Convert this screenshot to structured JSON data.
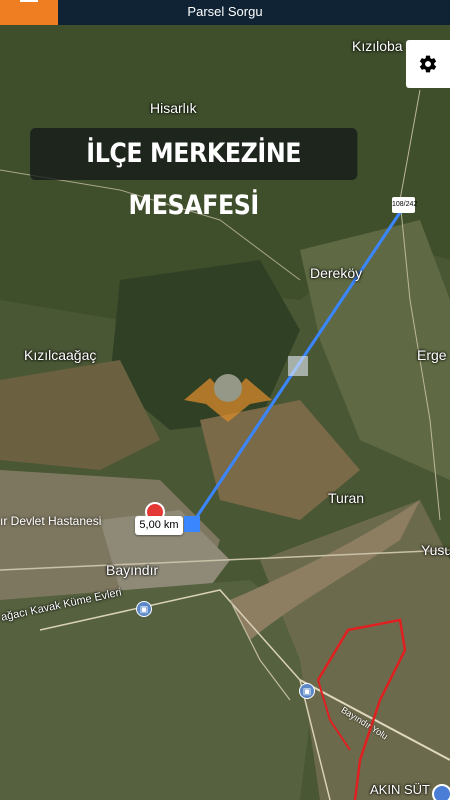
{
  "app": {
    "title": "Parsel Sorgu"
  },
  "heading": "İLÇE MERKEZİNE MESAFESİ",
  "measure": {
    "distance": "5,00 km",
    "end_tag": "108/242"
  },
  "hospital": {
    "label": "ır Devlet Hastanesi"
  },
  "places": {
    "kizilova": "Kızıloba",
    "hisarlik": "Hisarlık",
    "derekoy": "Dereköy",
    "kizilcaagac": "Kızılcaağaç",
    "erge": "Erge",
    "turan": "Turan",
    "bayindir": "Bayındır",
    "yusuf": "Yusu",
    "kavak": "ağacı Kavak Küme Evleri",
    "akin": "AKIN SÜT"
  },
  "road": {
    "label": "Bayındır Yolu"
  },
  "colors": {
    "accent": "#ef7d22",
    "topbar": "#0f2334",
    "measure_line": "#3a86ff",
    "parcel_outline": "#e02020"
  },
  "icons": {
    "menu": "hamburger-icon",
    "settings": "gear-icon",
    "train": "train-icon"
  }
}
